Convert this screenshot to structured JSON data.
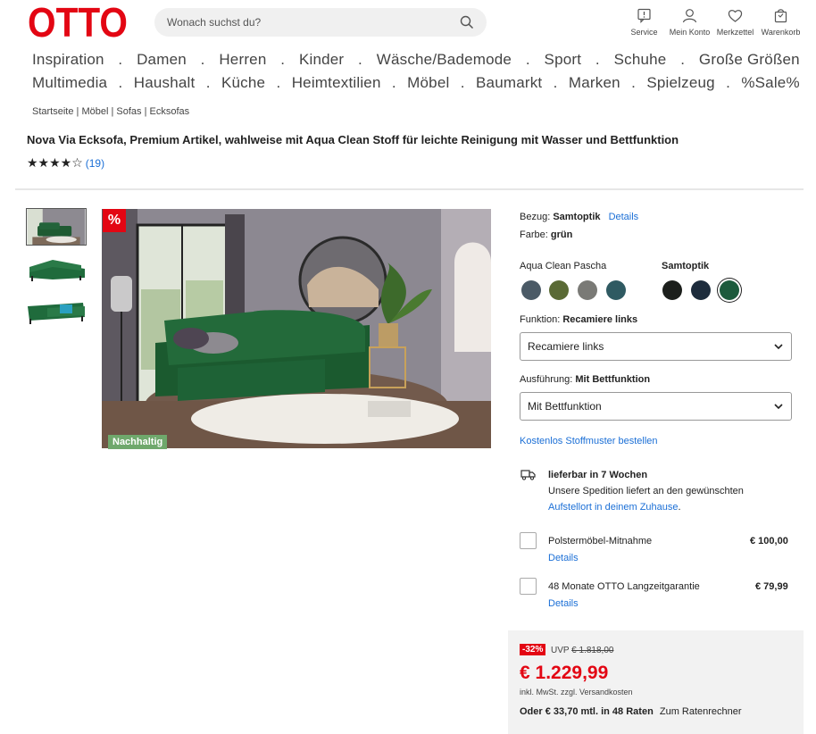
{
  "header": {
    "logo_text": "OTTO",
    "search_placeholder": "Wonach suchst du?",
    "icons": [
      {
        "label": "Service",
        "icon": "service-icon"
      },
      {
        "label": "Mein Konto",
        "icon": "account-icon"
      },
      {
        "label": "Merkzettel",
        "icon": "heart-icon"
      },
      {
        "label": "Warenkorb",
        "icon": "cart-icon"
      }
    ]
  },
  "nav": {
    "row1": [
      "Inspiration",
      "Damen",
      "Herren",
      "Kinder",
      "Wäsche/Bademode",
      "Sport",
      "Schuhe",
      "Große Größen"
    ],
    "row2": [
      "Multimedia",
      "Haushalt",
      "Küche",
      "Heimtextilien",
      "Möbel",
      "Baumarkt",
      "Marken",
      "Spielzeug",
      "%Sale%"
    ],
    "separator": "."
  },
  "breadcrumb": [
    "Startseite",
    "Möbel",
    "Sofas",
    "Ecksofas"
  ],
  "product": {
    "title": "Nova Via Ecksofa, Premium Artikel, wahlweise mit Aqua Clean Stoff für leichte Reinigung mit Wasser und Bettfunktion",
    "stars": "★★★★☆",
    "rating_value": 4,
    "review_count": "(19)",
    "badge_percent": "%",
    "badge_sustainable": "Nachhaltig"
  },
  "options": {
    "bezug_label": "Bezug:",
    "bezug_value": "Samtoptik",
    "details_link": "Details",
    "farbe_label": "Farbe:",
    "farbe_value": "grün",
    "group1_label": "Aqua Clean Pascha",
    "group2_label": "Samtoptik",
    "swatches_group1": [
      "#4b5a66",
      "#5a6a35",
      "#7a7a76",
      "#2f5a62"
    ],
    "swatches_group2": [
      "#1c1f1c",
      "#1d2c3c",
      "#1c5a3c"
    ],
    "selected_swatch": "#1c5a3c",
    "funktion_label": "Funktion:",
    "funktion_value": "Recamiere links",
    "funktion_select": "Recamiere links",
    "ausfuehrung_label": "Ausführung:",
    "ausfuehrung_value": "Mit Bettfunktion",
    "ausfuehrung_select": "Mit Bettfunktion",
    "stoffmuster_link": "Kostenlos Stoffmuster bestellen"
  },
  "delivery": {
    "title": "lieferbar in 7 Wochen",
    "line1": "Unsere Spedition liefert an den gewünschten",
    "line2_link": "Aufstellort in deinem Zuhause",
    "line2_end": "."
  },
  "services": [
    {
      "label": "Polstermöbel-Mitnahme",
      "price": "€ 100,00",
      "details": "Details"
    },
    {
      "label": "48 Monate OTTO Langzeitgarantie",
      "price": "€ 79,99",
      "details": "Details"
    }
  ],
  "price": {
    "discount": "-32%",
    "uvp_label": "UVP",
    "uvp_value": "€ 1.818,00",
    "current": "€ 1.229,99",
    "mwst": "inkl. MwSt. zzgl. Versandkosten",
    "rate_text": "Oder € 33,70 mtl. in 48 Raten",
    "rate_link": "Zum Ratenrechner"
  },
  "colors": {
    "brand_red": "#e30613",
    "link_blue": "#1b6fd6",
    "sustainable_green": "#6fa86c"
  }
}
